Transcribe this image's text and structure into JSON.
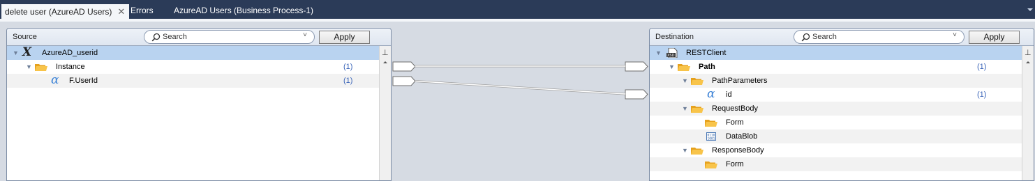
{
  "tabs": [
    {
      "label": "delete user (AzureAD Users)",
      "active": true,
      "closable": true
    },
    {
      "label": "Errors",
      "active": false
    },
    {
      "label": "AzureAD Users (Business Process-1)",
      "active": false
    }
  ],
  "source": {
    "title": "Source",
    "search_placeholder": "Search",
    "apply_label": "Apply",
    "rows": [
      {
        "label": "AzureAD_userid",
        "icon": "x-variable-icon",
        "count": ""
      },
      {
        "label": "Instance",
        "icon": "folder-icon",
        "count": "(1)"
      },
      {
        "label": "F.UserId",
        "icon": "alpha-field-icon",
        "count": "(1)"
      }
    ]
  },
  "destination": {
    "title": "Destination",
    "search_placeholder": "Search",
    "apply_label": "Apply",
    "rows": [
      {
        "label": "RESTClient",
        "icon": "xsd-schema-icon",
        "count": ""
      },
      {
        "label": "Path",
        "icon": "folder-icon",
        "count": "(1)"
      },
      {
        "label": "PathParameters",
        "icon": "folder-icon",
        "count": ""
      },
      {
        "label": "id",
        "icon": "alpha-field-icon",
        "count": "(1)"
      },
      {
        "label": "RequestBody",
        "icon": "folder-icon",
        "count": ""
      },
      {
        "label": "Form",
        "icon": "folder-icon",
        "count": ""
      },
      {
        "label": "DataBlob",
        "icon": "binary-data-icon",
        "count": ""
      },
      {
        "label": "ResponseBody",
        "icon": "folder-icon",
        "count": ""
      },
      {
        "label": "Form",
        "icon": "folder-icon",
        "count": ""
      }
    ]
  },
  "colors": {
    "tabbar": "#2b3b58",
    "selected_row": "#b9d3f0",
    "count_text": "#3a64b8",
    "folder": "#f3b530"
  }
}
